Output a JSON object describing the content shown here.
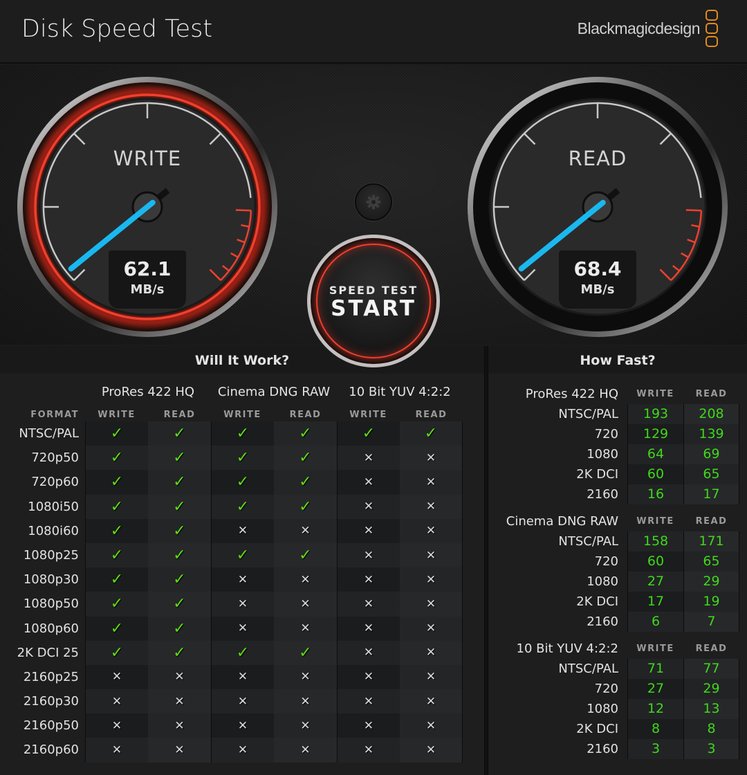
{
  "window": {
    "close_icon": "close-icon"
  },
  "header": {
    "title": "Disk Speed Test",
    "brand": "Blackmagicdesign",
    "brand_accent": "#e08a1c"
  },
  "gauges": {
    "write": {
      "label": "WRITE",
      "value": "62.1",
      "unit": "MB/s"
    },
    "read": {
      "label": "READ",
      "value": "68.4",
      "unit": "MB/s"
    },
    "needle_color": "#1ab8f0",
    "redline_color": "#f0402e"
  },
  "controls": {
    "settings_icon": "gear-icon",
    "start_sub": "SPEED TEST",
    "start_main": "START"
  },
  "will_it_work": {
    "title": "Will It Work?",
    "format_header": "FORMAT",
    "groups": [
      "ProRes 422 HQ",
      "Cinema DNG RAW",
      "10 Bit YUV 4:2:2"
    ],
    "subheaders": [
      "WRITE",
      "READ",
      "WRITE",
      "READ",
      "WRITE",
      "READ"
    ],
    "rows": [
      {
        "format": "NTSC/PAL",
        "results": [
          true,
          true,
          true,
          true,
          true,
          true
        ]
      },
      {
        "format": "720p50",
        "results": [
          true,
          true,
          true,
          true,
          false,
          false
        ]
      },
      {
        "format": "720p60",
        "results": [
          true,
          true,
          true,
          true,
          false,
          false
        ]
      },
      {
        "format": "1080i50",
        "results": [
          true,
          true,
          true,
          true,
          false,
          false
        ]
      },
      {
        "format": "1080i60",
        "results": [
          true,
          true,
          false,
          false,
          false,
          false
        ]
      },
      {
        "format": "1080p25",
        "results": [
          true,
          true,
          true,
          true,
          false,
          false
        ]
      },
      {
        "format": "1080p30",
        "results": [
          true,
          true,
          false,
          false,
          false,
          false
        ]
      },
      {
        "format": "1080p50",
        "results": [
          true,
          true,
          false,
          false,
          false,
          false
        ]
      },
      {
        "format": "1080p60",
        "results": [
          true,
          true,
          false,
          false,
          false,
          false
        ]
      },
      {
        "format": "2K DCI 25",
        "results": [
          true,
          true,
          true,
          true,
          false,
          false
        ]
      },
      {
        "format": "2160p25",
        "results": [
          false,
          false,
          false,
          false,
          false,
          false
        ]
      },
      {
        "format": "2160p30",
        "results": [
          false,
          false,
          false,
          false,
          false,
          false
        ]
      },
      {
        "format": "2160p50",
        "results": [
          false,
          false,
          false,
          false,
          false,
          false
        ]
      },
      {
        "format": "2160p60",
        "results": [
          false,
          false,
          false,
          false,
          false,
          false
        ]
      }
    ],
    "check_glyph": "✓",
    "cross_glyph": "✕",
    "check_color": "#5cdc13"
  },
  "how_fast": {
    "title": "How Fast?",
    "write_header": "WRITE",
    "read_header": "READ",
    "value_color": "#3fd81b",
    "sections": [
      {
        "name": "ProRes 422 HQ",
        "rows": [
          {
            "label": "NTSC/PAL",
            "write": "193",
            "read": "208"
          },
          {
            "label": "720",
            "write": "129",
            "read": "139"
          },
          {
            "label": "1080",
            "write": "64",
            "read": "69"
          },
          {
            "label": "2K DCI",
            "write": "60",
            "read": "65"
          },
          {
            "label": "2160",
            "write": "16",
            "read": "17"
          }
        ]
      },
      {
        "name": "Cinema DNG RAW",
        "rows": [
          {
            "label": "NTSC/PAL",
            "write": "158",
            "read": "171"
          },
          {
            "label": "720",
            "write": "60",
            "read": "65"
          },
          {
            "label": "1080",
            "write": "27",
            "read": "29"
          },
          {
            "label": "2K DCI",
            "write": "17",
            "read": "19"
          },
          {
            "label": "2160",
            "write": "6",
            "read": "7"
          }
        ]
      },
      {
        "name": "10 Bit YUV 4:2:2",
        "rows": [
          {
            "label": "NTSC/PAL",
            "write": "71",
            "read": "77"
          },
          {
            "label": "720",
            "write": "27",
            "read": "29"
          },
          {
            "label": "1080",
            "write": "12",
            "read": "13"
          },
          {
            "label": "2K DCI",
            "write": "8",
            "read": "8"
          },
          {
            "label": "2160",
            "write": "3",
            "read": "3"
          }
        ]
      }
    ]
  }
}
